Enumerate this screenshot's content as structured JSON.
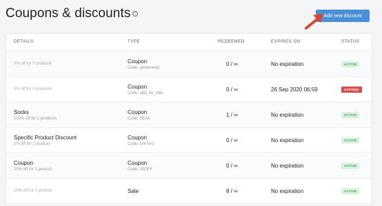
{
  "header": {
    "title": "Coupons & discounts",
    "info_icon": "info-icon",
    "add_button_label": "Add new discount"
  },
  "table": {
    "columns": [
      "DETAILS",
      "TYPE",
      "REDEEMED",
      "EXPIRES ON",
      "STATUS"
    ],
    "rows": [
      {
        "name": "",
        "detail": "0% off for 0 products",
        "type": "Coupon",
        "code": "Code: gndwswdp",
        "redeemed": "0 / ∞",
        "expires": "No expiration",
        "status": "ACTIVE"
      },
      {
        "name": "",
        "detail": "0% off for 0 products",
        "type": "Coupon",
        "code": "Code: abb_by_mile",
        "redeemed": "0 / ∞",
        "expires": "26 Sep 2020 06:59",
        "status": "EXPIRED"
      },
      {
        "name": "Socks",
        "detail": "100% off for 2 products",
        "type": "Coupon",
        "code": "Code: DEAL",
        "redeemed": "1 / ∞",
        "expires": "No expiration",
        "status": "ACTIVE"
      },
      {
        "name": "Specific Product Discount",
        "detail": "1% off for 1 product",
        "type": "Coupon",
        "code": "Code: lmeTest",
        "redeemed": "0 / ∞",
        "expires": "No expiration",
        "status": "ACTIVE"
      },
      {
        "name": "Coupon",
        "detail": "20% off for 1 product",
        "type": "Coupon",
        "code": "Code: 20OFF",
        "redeemed": "0 / ∞",
        "expires": "No expiration",
        "status": "ACTIVE"
      },
      {
        "name": "",
        "detail": "10% off for 1 product",
        "type": "Sale",
        "code": "",
        "redeemed": "8 / ∞",
        "expires": "No expiration",
        "status": "ACTIVE"
      }
    ]
  },
  "colors": {
    "accent": "#4a90d9",
    "active_bg": "#d9f2df",
    "active_text": "#3a9b52",
    "expired_bg": "#e24b45",
    "arrow": "#e0452a"
  }
}
